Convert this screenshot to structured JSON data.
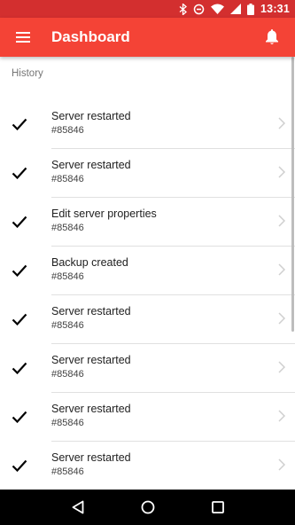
{
  "status_bar": {
    "time": "13:31",
    "icons": [
      "bluetooth-icon",
      "vibrate-icon",
      "wifi-icon",
      "signal-icon",
      "battery-icon"
    ]
  },
  "app_bar": {
    "title": "Dashboard",
    "menu_icon": "menu-icon",
    "notification_icon": "bell-icon",
    "color": "#f44336",
    "status_color": "#d32f2f"
  },
  "section": {
    "header": "History"
  },
  "history": [
    {
      "title": "Server restarted",
      "subtitle": "#85846"
    },
    {
      "title": "Server restarted",
      "subtitle": "#85846"
    },
    {
      "title": "Edit server properties",
      "subtitle": "#85846"
    },
    {
      "title": "Backup created",
      "subtitle": "#85846"
    },
    {
      "title": "Server restarted",
      "subtitle": "#85846"
    },
    {
      "title": "Server restarted",
      "subtitle": "#85846"
    },
    {
      "title": "Server restarted",
      "subtitle": "#85846"
    },
    {
      "title": "Server restarted",
      "subtitle": "#85846"
    }
  ],
  "nav_bar": {
    "buttons": [
      "back-icon",
      "home-icon",
      "recents-icon"
    ]
  }
}
